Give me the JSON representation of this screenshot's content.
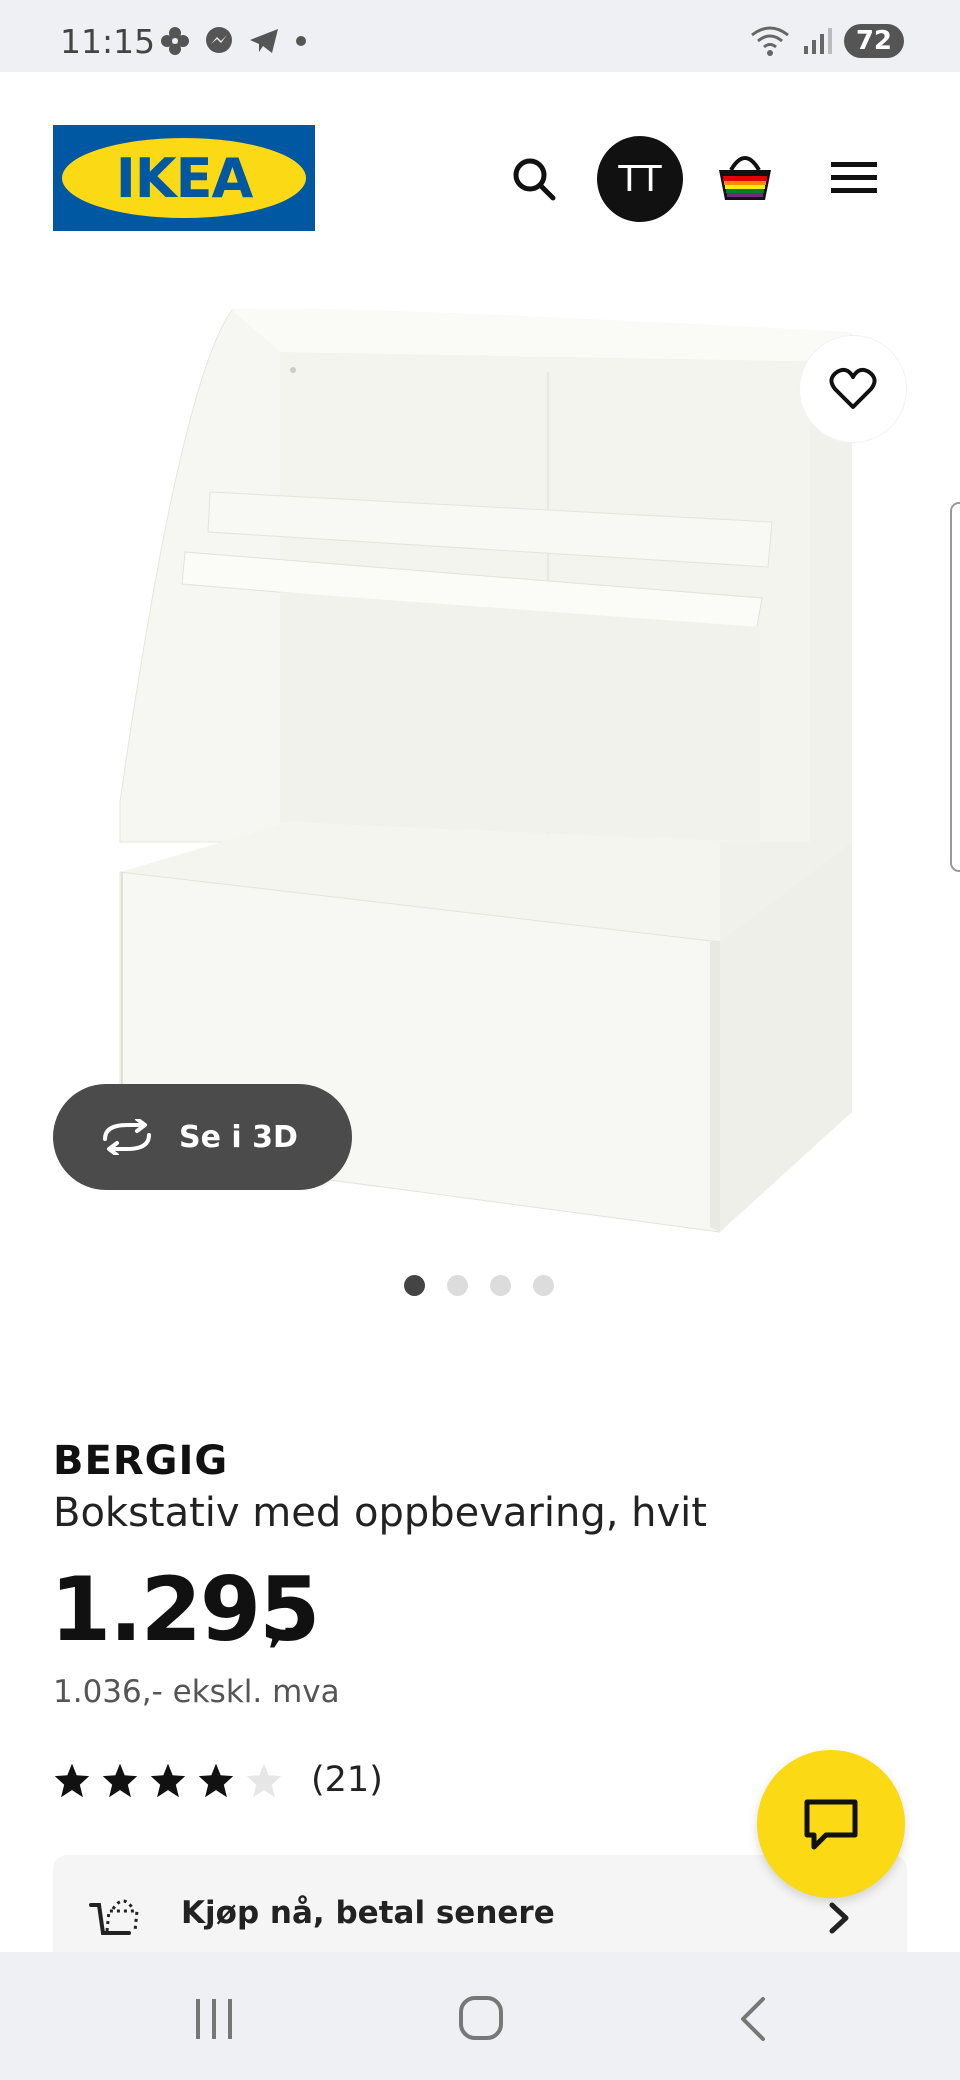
{
  "status_bar": {
    "time": "11:15",
    "battery": "72"
  },
  "header": {
    "logo_text": "IKEA",
    "avatar_initials": "TT"
  },
  "gallery": {
    "see_3d_label": "Se i 3D",
    "dots_total": 4,
    "active_index": 0
  },
  "product": {
    "brand": "BERGIG",
    "description": "Bokstativ med oppbevaring, hvit",
    "price": "1.295",
    "price_suffix": ",-",
    "price_ex_vat": "1.036,- ekskl. mva",
    "rating_value": 4,
    "rating_max": 5,
    "rating_count": "(21)"
  },
  "pay_later": {
    "label": "Kjøp nå, betal senere"
  },
  "colors": {
    "ikea_blue": "#0058a3",
    "ikea_yellow": "#fbd914",
    "dark": "#111111"
  }
}
